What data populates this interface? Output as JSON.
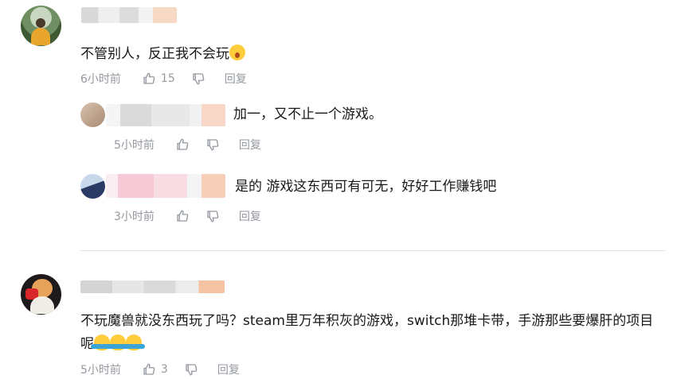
{
  "comments": [
    {
      "text": "不管别人，反正我不会玩",
      "emoji": "shocked-face-icon",
      "time": "6小时前",
      "likes": "15",
      "reply_label": "回复",
      "replies": [
        {
          "text": "加一，又不止一个游戏。",
          "time": "5小时前",
          "reply_label": "回复"
        },
        {
          "text": "是的 游戏这东西可有可无，好好工作赚钱吧",
          "time": "3小时前",
          "reply_label": "回复"
        }
      ]
    },
    {
      "text": "不玩魔兽就没东西玩了吗？steam里万年积灰的游戏，switch那堆卡带，手游那些要爆肝的项目呢",
      "emoji": "shrug-icon",
      "time": "5小时前",
      "likes": "3",
      "reply_label": "回复"
    }
  ],
  "colors": {
    "meta_gray": "#9499a0",
    "text": "#18191c",
    "divider": "#e3e5e7"
  }
}
